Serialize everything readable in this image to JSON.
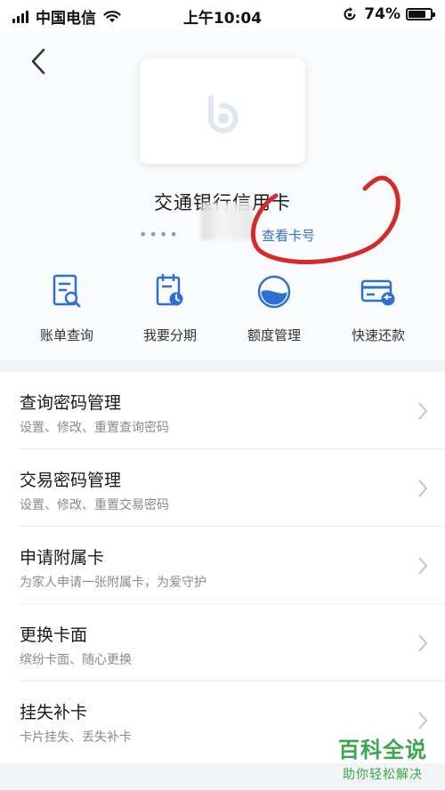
{
  "status_bar": {
    "carrier": "中国电信",
    "time": "上午10:04",
    "battery": "74%"
  },
  "card": {
    "title": "交通银行信用卡",
    "number_masked": "••••",
    "view_number": "查看卡号"
  },
  "actions": [
    {
      "label": "账单查询",
      "icon": "bill-search-icon"
    },
    {
      "label": "我要分期",
      "icon": "installment-icon"
    },
    {
      "label": "额度管理",
      "icon": "credit-limit-icon"
    },
    {
      "label": "快速还款",
      "icon": "quick-repay-icon"
    }
  ],
  "menu": [
    {
      "title": "查询密码管理",
      "subtitle": "设置、修改、重置查询密码"
    },
    {
      "title": "交易密码管理",
      "subtitle": "设置、修改、重置交易密码"
    },
    {
      "title": "申请附属卡",
      "subtitle": "为家人申请一张附属卡，为爱守护"
    },
    {
      "title": "更换卡面",
      "subtitle": "缤纷卡面、随心更换"
    },
    {
      "title": "挂失补卡",
      "subtitle": "卡片挂失、丢失补卡"
    }
  ],
  "watermark": {
    "title": "百科全说",
    "subtitle": "助你轻松解决"
  },
  "colors": {
    "accent": "#2e6fd3",
    "annotation": "#d42a2a",
    "watermark": "#3aa64d"
  }
}
